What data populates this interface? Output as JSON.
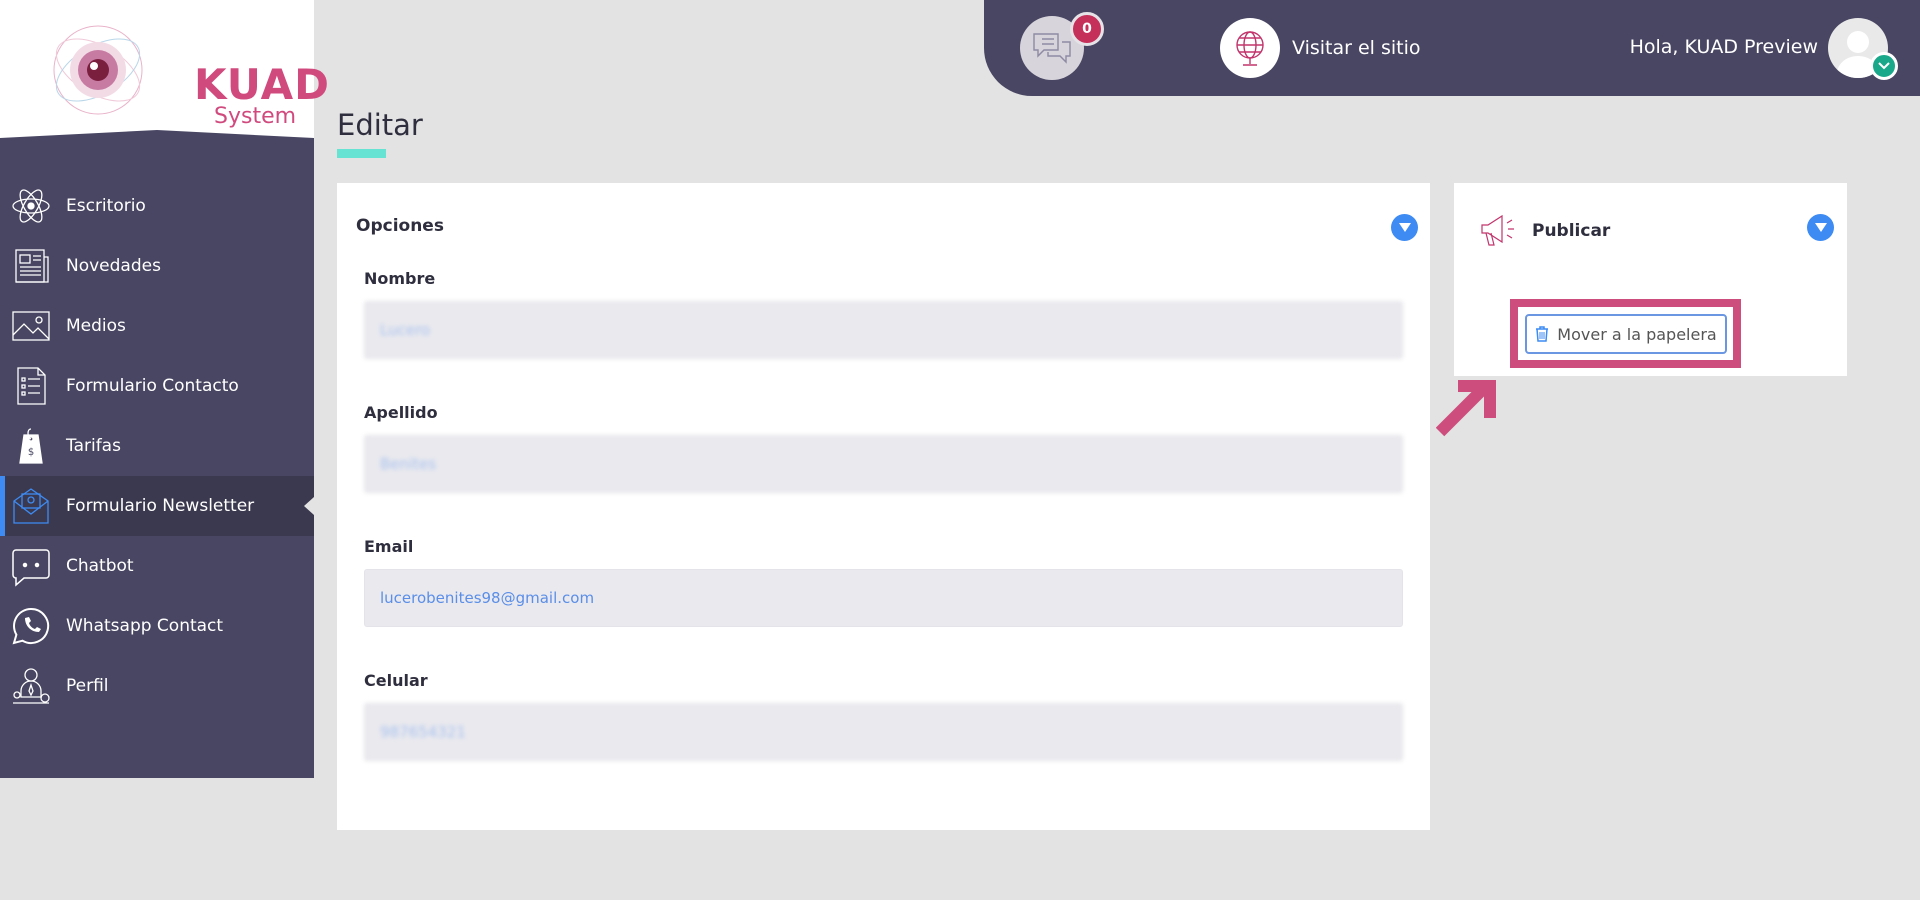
{
  "logo": {
    "brand": "KUAD",
    "sub": "System"
  },
  "sidebar": {
    "items": [
      {
        "label": "Escritorio",
        "icon": "atom-icon"
      },
      {
        "label": "Novedades",
        "icon": "newspaper-icon"
      },
      {
        "label": "Medios",
        "icon": "image-icon"
      },
      {
        "label": "Formulario Contacto",
        "icon": "form-icon"
      },
      {
        "label": "Tarifas",
        "icon": "price-tag-icon"
      },
      {
        "label": "Formulario Newsletter",
        "icon": "mail-icon",
        "active": true
      },
      {
        "label": "Chatbot",
        "icon": "chatbot-icon"
      },
      {
        "label": "Whatsapp Contact",
        "icon": "whatsapp-icon"
      },
      {
        "label": "Perfil",
        "icon": "profile-icon"
      }
    ]
  },
  "topbar": {
    "notification_count": "0",
    "visit_label": "Visitar el sitio",
    "greeting": "Hola, KUAD Preview"
  },
  "page": {
    "title": "Editar"
  },
  "options_card": {
    "title": "Opciones",
    "fields": [
      {
        "label": "Nombre",
        "value": "Lucero"
      },
      {
        "label": "Apellido",
        "value": "Benites"
      },
      {
        "label": "Email",
        "value": "lucerobenites98@gmail.com"
      },
      {
        "label": "Celular",
        "value": "987654321"
      }
    ]
  },
  "publish_card": {
    "title": "Publicar",
    "trash_label": "Mover a la papelera"
  },
  "colors": {
    "sidebar_bg": "#484662",
    "accent_pink": "#cd4d7d",
    "accent_blue": "#3d8bf3",
    "title_underline": "#67e3d3",
    "badge": "#c5305a"
  }
}
